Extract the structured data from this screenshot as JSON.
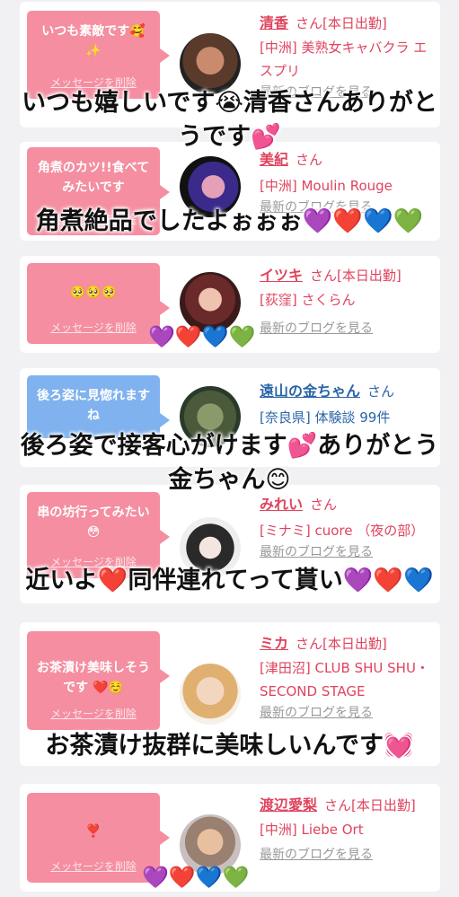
{
  "delete_label": "メッセージを削除",
  "blog_label": "最新のブログを見る",
  "san": "さん",
  "cards": [
    {
      "message": "いつも素敵です🥰✨",
      "name": "清香",
      "status": "[本日出勤]",
      "shop": "[中洲] 美熟女キャバクラ エスプリ",
      "bubble_color": "#f48ea0"
    },
    {
      "message": "角煮のカツ!!食べてみたいです",
      "name": "美紀",
      "status": "",
      "shop": "[中洲] Moulin Rouge",
      "bubble_color": "#f48ea0"
    },
    {
      "message": "🥺🥺🥺",
      "name": "イツキ",
      "status": "[本日出勤]",
      "shop": "[荻窪] さくらん",
      "bubble_color": "#f48ea0"
    },
    {
      "message": "後ろ姿に見惚れますね",
      "name": "遠山の金ちゃん",
      "status": "",
      "shop": "[奈良県] 体験談 99件",
      "bubble_color": "#7fb2ee"
    },
    {
      "message": "串の坊行ってみたい😳",
      "name": "みれい",
      "status": "",
      "shop": "[ミナミ] cuore （夜の部）",
      "bubble_color": "#f48ea0"
    },
    {
      "message": "お茶漬け美味しそうです ❤️☺️",
      "name": "ミカ",
      "status": "[本日出勤]",
      "shop": "[津田沼] CLUB SHU SHU・SECOND STAGE",
      "bubble_color": "#f48ea0"
    },
    {
      "message": "❣️",
      "name": "渡辺愛梨",
      "status": "[本日出勤]",
      "shop": "[中洲] Liebe Ort",
      "bubble_color": "#f48ea0"
    }
  ],
  "captions": [
    "いつも嬉しいです😭清香さんありがとうです💕",
    "角煮絶品でしたよぉぉぉ💜❤️💙💚",
    "💜❤️💙💚",
    "後ろ姿で接客心がけます💕ありがとう金ちゃん😊",
    "近いよ❤️同伴連れてって貰い💜❤️💙",
    "お茶漬け抜群に美味しいんです💓",
    "💜❤️💙💚"
  ]
}
